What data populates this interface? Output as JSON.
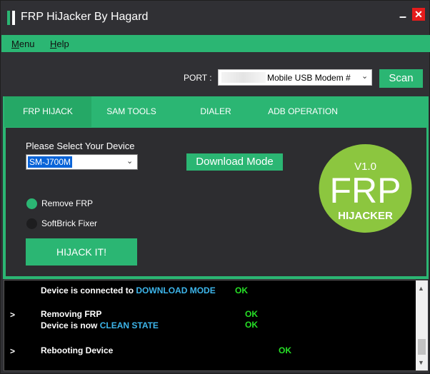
{
  "window": {
    "title": "FRP HiJacker By Hagard",
    "minimize_glyph": "–",
    "close_glyph": "✕"
  },
  "menu": {
    "items": [
      {
        "label": "Menu",
        "underline": "M",
        "rest": "enu"
      },
      {
        "label": "Help",
        "underline": "H",
        "rest": "elp"
      }
    ]
  },
  "port": {
    "label": "PORT :",
    "value": "Mobile USB Modem #",
    "scan_label": "Scan"
  },
  "tabs": [
    {
      "label": "FRP HIJACK",
      "active": true
    },
    {
      "label": "SAM TOOLS",
      "active": false
    },
    {
      "label": "DIALER",
      "active": false
    },
    {
      "label": "ADB OPERATION",
      "active": false
    }
  ],
  "frp_tab": {
    "select_label": "Please Select Your Device",
    "device_value": "SM-J700M",
    "download_mode_label": "Download Mode",
    "radios": [
      {
        "label": "Remove FRP",
        "checked": true
      },
      {
        "label": "SoftBrick Fixer",
        "checked": false
      }
    ],
    "hijack_label": "HIJACK IT!"
  },
  "logo": {
    "version": "V1.0",
    "big": "FRP",
    "small": "HIJACKER"
  },
  "log": {
    "lines": [
      {
        "arrow": "",
        "parts": [
          "Device is connected to ",
          "DOWNLOAD MODE"
        ],
        "status": "OK"
      },
      {
        "arrow": ">",
        "parts": [
          "Removing FRP"
        ],
        "status": "OK"
      },
      {
        "arrow": "",
        "parts": [
          "Device is now ",
          "CLEAN STATE"
        ],
        "status": "OK"
      },
      {
        "arrow": ">",
        "parts": [
          "Rebooting Device"
        ],
        "status": "OK"
      }
    ]
  },
  "colors": {
    "accent": "#2bb673",
    "background": "#2d2d30",
    "log_blue": "#3db5ea",
    "ok_green": "#26e026",
    "close_red": "#e51c1c"
  }
}
